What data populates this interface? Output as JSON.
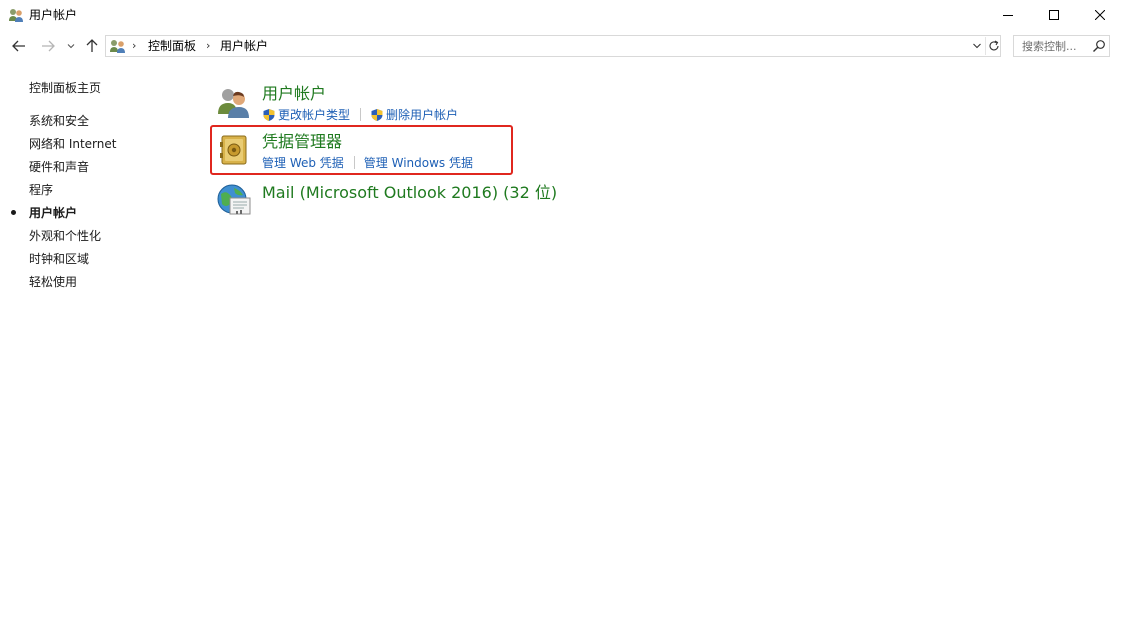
{
  "window": {
    "title": "用户帐户"
  },
  "address": {
    "crumbs": [
      "控制面板",
      "用户帐户"
    ],
    "separator": "›"
  },
  "search": {
    "placeholder": "搜索控制..."
  },
  "sidebar": {
    "home": "控制面板主页",
    "items": [
      {
        "label": "系统和安全",
        "active": false
      },
      {
        "label": "网络和 Internet",
        "active": false
      },
      {
        "label": "硬件和声音",
        "active": false
      },
      {
        "label": "程序",
        "active": false
      },
      {
        "label": "用户帐户",
        "active": true
      },
      {
        "label": "外观和个性化",
        "active": false
      },
      {
        "label": "时钟和区域",
        "active": false
      },
      {
        "label": "轻松使用",
        "active": false
      }
    ]
  },
  "main": {
    "categories": [
      {
        "title": "用户帐户",
        "icon": "users-icon",
        "links": [
          {
            "label": "更改帐户类型",
            "shield": true
          },
          {
            "label": "删除用户帐户",
            "shield": true
          }
        ]
      },
      {
        "title": "凭据管理器",
        "icon": "credential-vault-icon",
        "highlighted": true,
        "links": [
          {
            "label": "管理 Web 凭据",
            "shield": false
          },
          {
            "label": "管理 Windows 凭据",
            "shield": false
          }
        ]
      },
      {
        "title": "Mail (Microsoft Outlook 2016) (32 位)",
        "icon": "mail-icon",
        "links": []
      }
    ]
  },
  "colors": {
    "category_title": "#1f7a1f",
    "link": "#1d5fb5",
    "highlight": "#e0271f"
  }
}
